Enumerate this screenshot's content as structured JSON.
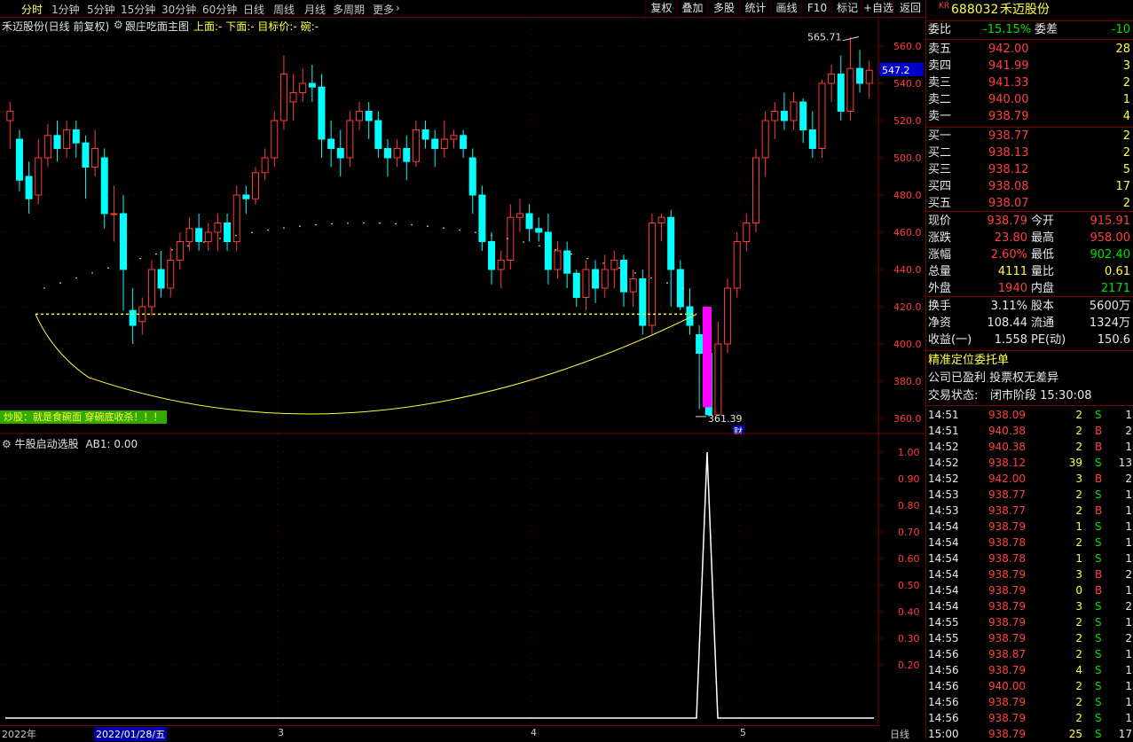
{
  "toolbar": {
    "left_items": [
      "分时",
      "1分钟",
      "5分钟",
      "15分钟",
      "30分钟",
      "60分钟",
      "日线",
      "周线",
      "月线",
      "多周期",
      "更多"
    ],
    "right_items": [
      "复权",
      "叠加",
      "多股",
      "统计",
      "画线",
      "F10",
      "标记",
      "+自选",
      "返回"
    ]
  },
  "info": {
    "stock_title": "禾迈股份(日线 前复权)",
    "indicator_name": "跟庄吃面主图",
    "fields": "上面:-  下面:-  目标价:-  碗:-",
    "banner": "炒股：就是食碗面 穿碗底收杀！！！"
  },
  "price_axis": {
    "labels": [
      "560.0",
      "540.0",
      "520.0",
      "500.0",
      "480.0",
      "460.0",
      "440.0",
      "420.0",
      "400.0",
      "380.0",
      "360.0"
    ],
    "current": "547.2",
    "high_mark": "565.71",
    "low_mark": "361.39",
    "badge": "财"
  },
  "indicator": {
    "title": "牛股启动选股",
    "value": "AB1: 0.00",
    "axis": [
      "1.00",
      "0.90",
      "0.80",
      "0.70",
      "0.60",
      "0.50",
      "0.40",
      "0.30",
      "0.20"
    ]
  },
  "date_axis": [
    "2022年",
    "2022/01/28/五",
    "3",
    "4",
    "5"
  ],
  "date_axis_right": "日线",
  "quote": {
    "code_prefix": "KR",
    "code": "688032",
    "name": "禾迈股份",
    "weibi_label": "委比",
    "weibi": "-15.15%",
    "weicha_label": "委差",
    "weicha": "-10",
    "asks": [
      {
        "label": "卖五",
        "price": "942.00",
        "vol": "28"
      },
      {
        "label": "卖四",
        "price": "941.99",
        "vol": "3"
      },
      {
        "label": "卖三",
        "price": "941.33",
        "vol": "2"
      },
      {
        "label": "卖二",
        "price": "940.00",
        "vol": "1"
      },
      {
        "label": "卖一",
        "price": "938.79",
        "vol": "4"
      }
    ],
    "bids": [
      {
        "label": "买一",
        "price": "938.77",
        "vol": "2"
      },
      {
        "label": "买二",
        "price": "938.13",
        "vol": "2"
      },
      {
        "label": "买三",
        "price": "938.12",
        "vol": "5"
      },
      {
        "label": "买四",
        "price": "938.08",
        "vol": "17"
      },
      {
        "label": "买五",
        "price": "938.07",
        "vol": "2"
      }
    ],
    "stats": [
      {
        "l1": "现价",
        "v1": "938.79",
        "c1": "red",
        "l2": "今开",
        "v2": "915.91",
        "c2": "red"
      },
      {
        "l1": "涨跌",
        "v1": "23.80",
        "c1": "red",
        "l2": "最高",
        "v2": "958.00",
        "c2": "red"
      },
      {
        "l1": "涨幅",
        "v1": "2.60%",
        "c1": "red",
        "l2": "最低",
        "v2": "902.40",
        "c2": "green"
      },
      {
        "l1": "总量",
        "v1": "4111",
        "c1": "yellow",
        "l2": "量比",
        "v2": "0.61",
        "c2": "yellow"
      },
      {
        "l1": "外盘",
        "v1": "1940",
        "c1": "red",
        "l2": "内盘",
        "v2": "2171",
        "c2": "green"
      }
    ],
    "stats2": [
      {
        "l1": "换手",
        "v1": "3.11%",
        "l2": "股本",
        "v2": "5600万"
      },
      {
        "l1": "净资",
        "v1": "108.44",
        "l2": "流通",
        "v2": "1324万"
      },
      {
        "l1": "收益(一)",
        "v1": "1.558",
        "l2": "PE(动)",
        "v2": "150.6"
      }
    ],
    "note1": "精准定位委托单",
    "note2": "公司已盈利 投票权无差异",
    "trade_status_label": "交易状态:",
    "trade_status": "闭市阶段 15:30:08",
    "ticks": [
      {
        "t": "14:51",
        "p": "938.09",
        "v": "2",
        "s": "S",
        "n": "1"
      },
      {
        "t": "14:51",
        "p": "940.38",
        "v": "2",
        "s": "B",
        "n": "2"
      },
      {
        "t": "14:52",
        "p": "940.38",
        "v": "2",
        "s": "B",
        "n": "1"
      },
      {
        "t": "14:52",
        "p": "938.12",
        "v": "39",
        "s": "S",
        "n": "13"
      },
      {
        "t": "14:52",
        "p": "942.00",
        "v": "3",
        "s": "B",
        "n": "2"
      },
      {
        "t": "14:53",
        "p": "938.77",
        "v": "2",
        "s": "S",
        "n": "1"
      },
      {
        "t": "14:53",
        "p": "938.77",
        "v": "2",
        "s": "B",
        "n": "1"
      },
      {
        "t": "14:54",
        "p": "938.79",
        "v": "1",
        "s": "S",
        "n": "1"
      },
      {
        "t": "14:54",
        "p": "938.78",
        "v": "2",
        "s": "S",
        "n": "1"
      },
      {
        "t": "14:54",
        "p": "938.78",
        "v": "1",
        "s": "S",
        "n": "1"
      },
      {
        "t": "14:54",
        "p": "938.79",
        "v": "3",
        "s": "B",
        "n": "2"
      },
      {
        "t": "14:54",
        "p": "938.79",
        "v": "0",
        "s": "B",
        "n": "1"
      },
      {
        "t": "14:54",
        "p": "938.79",
        "v": "3",
        "s": "S",
        "n": "2"
      },
      {
        "t": "14:55",
        "p": "938.79",
        "v": "2",
        "s": "S",
        "n": "1"
      },
      {
        "t": "14:55",
        "p": "938.79",
        "v": "2",
        "s": "S",
        "n": "2"
      },
      {
        "t": "14:56",
        "p": "938.87",
        "v": "2",
        "s": "S",
        "n": "1"
      },
      {
        "t": "14:56",
        "p": "938.79",
        "v": "4",
        "s": "S",
        "n": "1"
      },
      {
        "t": "14:56",
        "p": "940.00",
        "v": "2",
        "s": "S",
        "n": "1"
      },
      {
        "t": "14:56",
        "p": "938.79",
        "v": "2",
        "s": "S",
        "n": "1"
      },
      {
        "t": "14:56",
        "p": "938.79",
        "v": "2",
        "s": "S",
        "n": "1"
      },
      {
        "t": "15:00",
        "p": "938.79",
        "v": "25",
        "s": "S",
        "n": "17"
      }
    ]
  },
  "colors": {
    "up": "#ff3b3b",
    "down": "#00ffff",
    "accent": "#ffff40",
    "panel_border": "#7a0000",
    "magenta": "#ff00ff"
  }
}
